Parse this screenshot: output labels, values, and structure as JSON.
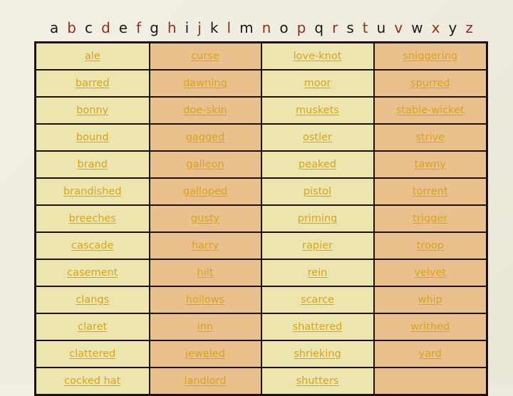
{
  "alphabet": {
    "letters": [
      {
        "ch": "a",
        "color": "dark"
      },
      {
        "ch": "b",
        "color": "red"
      },
      {
        "ch": "c",
        "color": "dark"
      },
      {
        "ch": "d",
        "color": "red"
      },
      {
        "ch": "e",
        "color": "dark"
      },
      {
        "ch": "f",
        "color": "red"
      },
      {
        "ch": "g",
        "color": "dark"
      },
      {
        "ch": "h",
        "color": "red"
      },
      {
        "ch": "i",
        "color": "dark"
      },
      {
        "ch": "j",
        "color": "red"
      },
      {
        "ch": "k",
        "color": "dark"
      },
      {
        "ch": "l",
        "color": "red"
      },
      {
        "ch": "m",
        "color": "dark"
      },
      {
        "ch": "n",
        "color": "red"
      },
      {
        "ch": "o",
        "color": "dark"
      },
      {
        "ch": "p",
        "color": "red"
      },
      {
        "ch": "q",
        "color": "dark"
      },
      {
        "ch": "r",
        "color": "red"
      },
      {
        "ch": "s",
        "color": "dark"
      },
      {
        "ch": "t",
        "color": "red"
      },
      {
        "ch": "u",
        "color": "dark"
      },
      {
        "ch": "v",
        "color": "red"
      },
      {
        "ch": "w",
        "color": "dark"
      },
      {
        "ch": "x",
        "color": "red"
      },
      {
        "ch": "y",
        "color": "dark"
      },
      {
        "ch": "z",
        "color": "red"
      }
    ],
    "dark_color": "#1a1a1a",
    "red_color": "#9a2b14"
  },
  "table": {
    "column_count": 4,
    "row_count": 13,
    "shade_light": "#ece5ad",
    "shade_tan": "#eac08c",
    "text_color": "#d9a41c",
    "border_color": "#1c1008",
    "rows": [
      [
        "ale",
        "curse",
        "love-knot",
        "sniggering"
      ],
      [
        "barred",
        "dawning",
        "moor",
        "spurred"
      ],
      [
        "bonny",
        "doe-skin",
        "muskets",
        "stable-wicket"
      ],
      [
        "bound",
        "gagged",
        "ostler",
        "strive"
      ],
      [
        "brand",
        "galleon",
        "peaked",
        "tawny"
      ],
      [
        "brandished",
        "galloped",
        "pistol",
        "torrent"
      ],
      [
        "breeches",
        "gusty",
        "priming",
        "trigger"
      ],
      [
        "cascade",
        "harry",
        "rapier",
        "troop"
      ],
      [
        "casement",
        "hilt",
        "rein",
        "velvet"
      ],
      [
        "clangs",
        "hollows",
        "scarce",
        "whip"
      ],
      [
        "claret",
        "inn",
        "shattered",
        "writhed"
      ],
      [
        "clattered",
        "jeweled",
        "shrieking",
        "yard"
      ],
      [
        "cocked hat",
        "landlord",
        "shutters",
        ""
      ]
    ]
  }
}
